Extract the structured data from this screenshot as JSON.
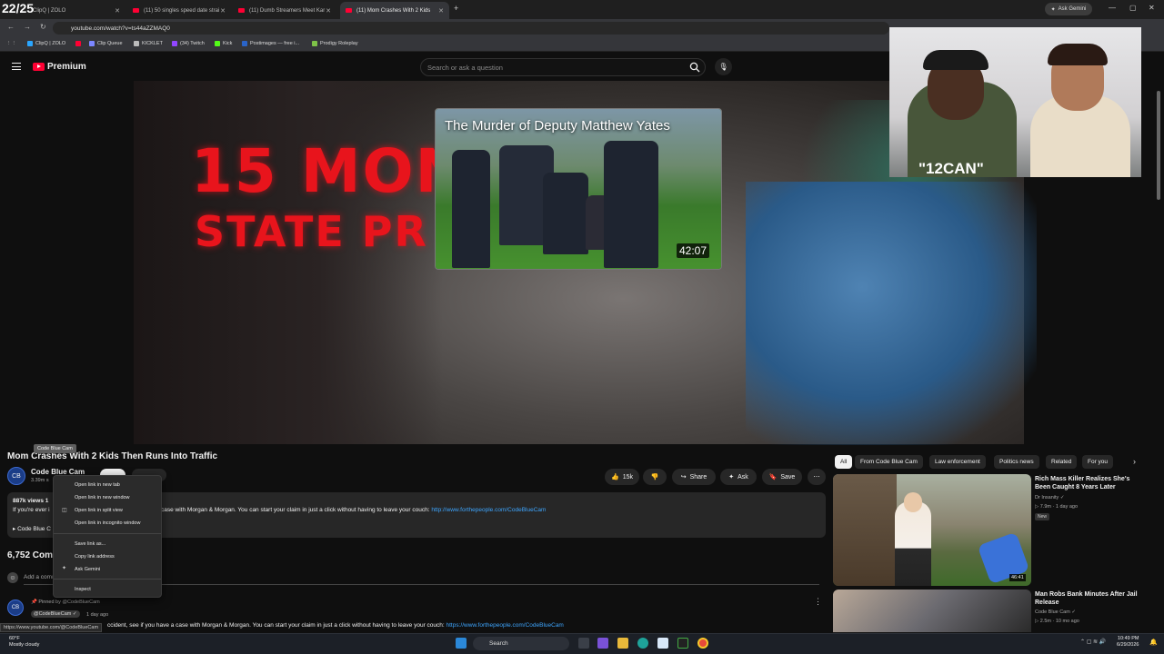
{
  "overlay": {
    "count": "22/25"
  },
  "browser": {
    "tabs": [
      {
        "label": "ClipQ | ZOLO",
        "active": false
      },
      {
        "label": "(11) 50 singles speed date strai",
        "active": false
      },
      {
        "label": "(11) Dumb Streamers Meet Kar",
        "active": false
      },
      {
        "label": "(11) Mom Crashes With 2 Kids",
        "active": true
      }
    ],
    "new_tab": "+",
    "ask_gemini": "Ask Gemini",
    "url": "youtube.com/watch?v=ts44aZZMAQ0",
    "bookmarks": [
      {
        "label": "ClipQ | ZOLO",
        "color": "#2aa6ff"
      },
      {
        "label": "",
        "color": "#ff0033"
      },
      {
        "label": "Clip Queue",
        "color": "#7b86ff"
      },
      {
        "label": "KICKLET",
        "color": "#bbbbbb"
      },
      {
        "label": "(34) Twitch",
        "color": "#9146ff"
      },
      {
        "label": "Kick",
        "color": "#53fc18"
      },
      {
        "label": "Postimages — free i...",
        "color": "#2a64c8"
      },
      {
        "label": "Prodigy Roleplay",
        "color": "#7ec248"
      }
    ]
  },
  "youtube": {
    "logo": "Premium",
    "search_placeholder": "Search or ask a question",
    "player": {
      "bg_text_line1": "15 MONT",
      "bg_text_line2": "STATE PR",
      "endcard_title": "The Murder of Deputy Matthew Yates",
      "endcard_duration": "42:07"
    },
    "webcam_text": "\"12CAN\"",
    "video_title": "Mom Crashes With 2 Kids Then Runs Into Traffic",
    "tooltip": "Code Blue Cam",
    "channel": {
      "name": "Code Blue Cam",
      "subs": "3.39m s",
      "avatar": "CB"
    },
    "actions": {
      "likes": "15k",
      "share": "Share",
      "ask": "Ask",
      "save": "Save"
    },
    "description": {
      "views": "887k views  1",
      "frag1": "If you're ever i",
      "frag2": "▸ Code Blue C",
      "line_text": "case with Morgan & Morgan. You can start your claim in just a click without having to leave your couch: ",
      "link": "http://www.forthepeople.com/CodeBlueCam"
    },
    "comments": {
      "count": "6,752 Comm",
      "add": "Add a comm",
      "pinned_by": "Pinned by @CodeBlueCam",
      "chip": "@CodeBlueCam ✓",
      "time": "1 day ago",
      "text": "ccident, see if you have a case with Morgan & Morgan. You can start your claim in just a click without having to leave your couch: ",
      "link": "https://www.forthepeople.com/CodeBlueCam"
    },
    "status_url": "https://www.youtube.com/@CodeBlueCam",
    "context_menu": [
      "Open link in new tab",
      "Open link in new window",
      "Open link in split view",
      "Open link in incognito window",
      "Save link as...",
      "Copy link address",
      "Ask Gemini",
      "Inspect"
    ],
    "chips": [
      "All",
      "From Code Blue Cam",
      "Law enforcement",
      "Politics news",
      "Related",
      "For you"
    ],
    "related": [
      {
        "title": "Rich Mass Killer Realizes She's Been Caught 8 Years Later",
        "channel": "Dr Insanity ✓",
        "meta": "▷ 7.9m · 1 day ago",
        "badge": "New",
        "duration": "46:41"
      },
      {
        "title": "Man Robs Bank Minutes After Jail Release",
        "channel": "Code Blue Cam ✓",
        "meta": "▷ 2.5m · 10 mo ago"
      }
    ]
  },
  "taskbar": {
    "weather_temp": "60°F",
    "weather_desc": "Mostly cloudy",
    "search": "Search",
    "time": "10:49 PM",
    "date": "6/29/2026"
  }
}
